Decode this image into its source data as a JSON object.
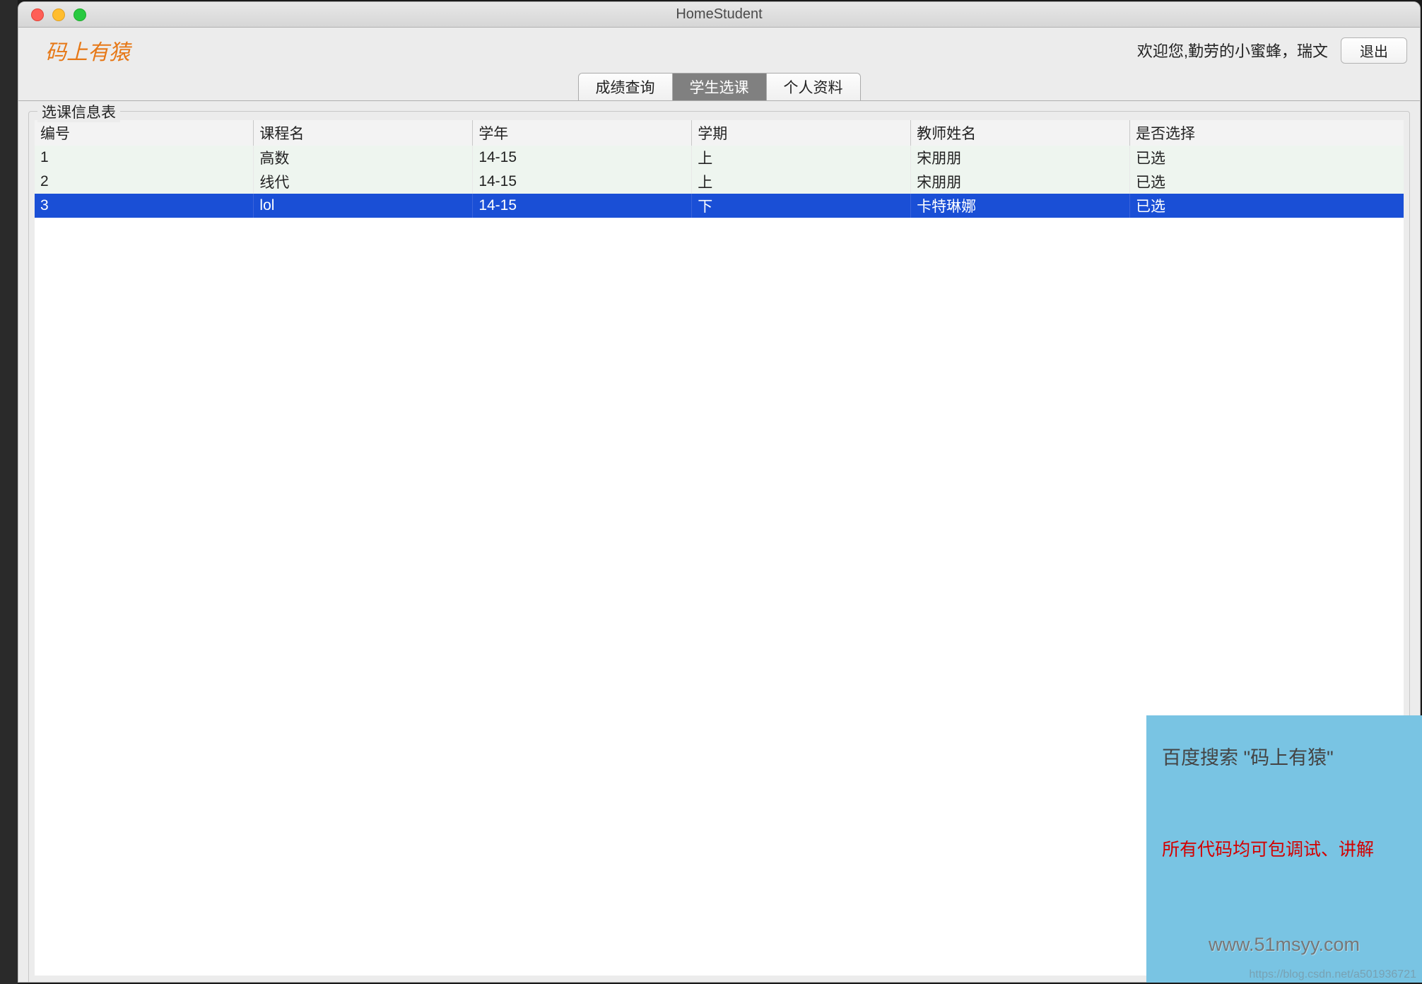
{
  "window": {
    "title": "HomeStudent"
  },
  "header": {
    "brand": "码上有猿",
    "welcome": "欢迎您,勤劳的小蜜蜂，瑞文",
    "logout": "退出"
  },
  "tabs": [
    {
      "label": "成绩查询",
      "active": false
    },
    {
      "label": "学生选课",
      "active": true
    },
    {
      "label": "个人资料",
      "active": false
    }
  ],
  "fieldset": {
    "legend": "选课信息表"
  },
  "table": {
    "columns": [
      "编号",
      "课程名",
      "学年",
      "学期",
      "教师姓名",
      "是否选择"
    ],
    "rows": [
      {
        "cells": [
          "1",
          "高数",
          "14-15",
          "上",
          "宋朋朋",
          "已选"
        ],
        "selected": false
      },
      {
        "cells": [
          "2",
          "线代",
          "14-15",
          "上",
          "宋朋朋",
          "已选"
        ],
        "selected": false
      },
      {
        "cells": [
          "3",
          "lol",
          "14-15",
          "下",
          "卡特琳娜",
          "已选"
        ],
        "selected": true
      }
    ]
  },
  "overlay": {
    "line1": "百度搜索 \"码上有猿\"",
    "line2": "所有代码均可包调试、讲解",
    "line3": "www.51msyy.com"
  },
  "watermark": "https://blog.csdn.net/a501936721"
}
